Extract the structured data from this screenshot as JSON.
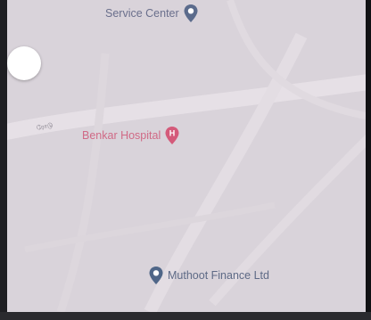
{
  "map": {
    "background_color": "#d9d3da",
    "road_color": "#e8e3e8",
    "road_labels": [
      "ரோடு"
    ],
    "pois": [
      {
        "name": "Service Center",
        "color": "#6a6f8c",
        "pin_color": "#5b6b8c",
        "icon": "map-pin-icon"
      },
      {
        "name": "Benkar Hospital",
        "color": "#d06a86",
        "pin_color": "#d45a7a",
        "icon": "hospital-icon",
        "pin_glyph": "H"
      },
      {
        "name": "Muthoot Finance Ltd",
        "color": "#5e6a86",
        "pin_color": "#4f6688",
        "icon": "map-pin-icon"
      }
    ],
    "control": {
      "icon": "circle-button-icon"
    }
  }
}
